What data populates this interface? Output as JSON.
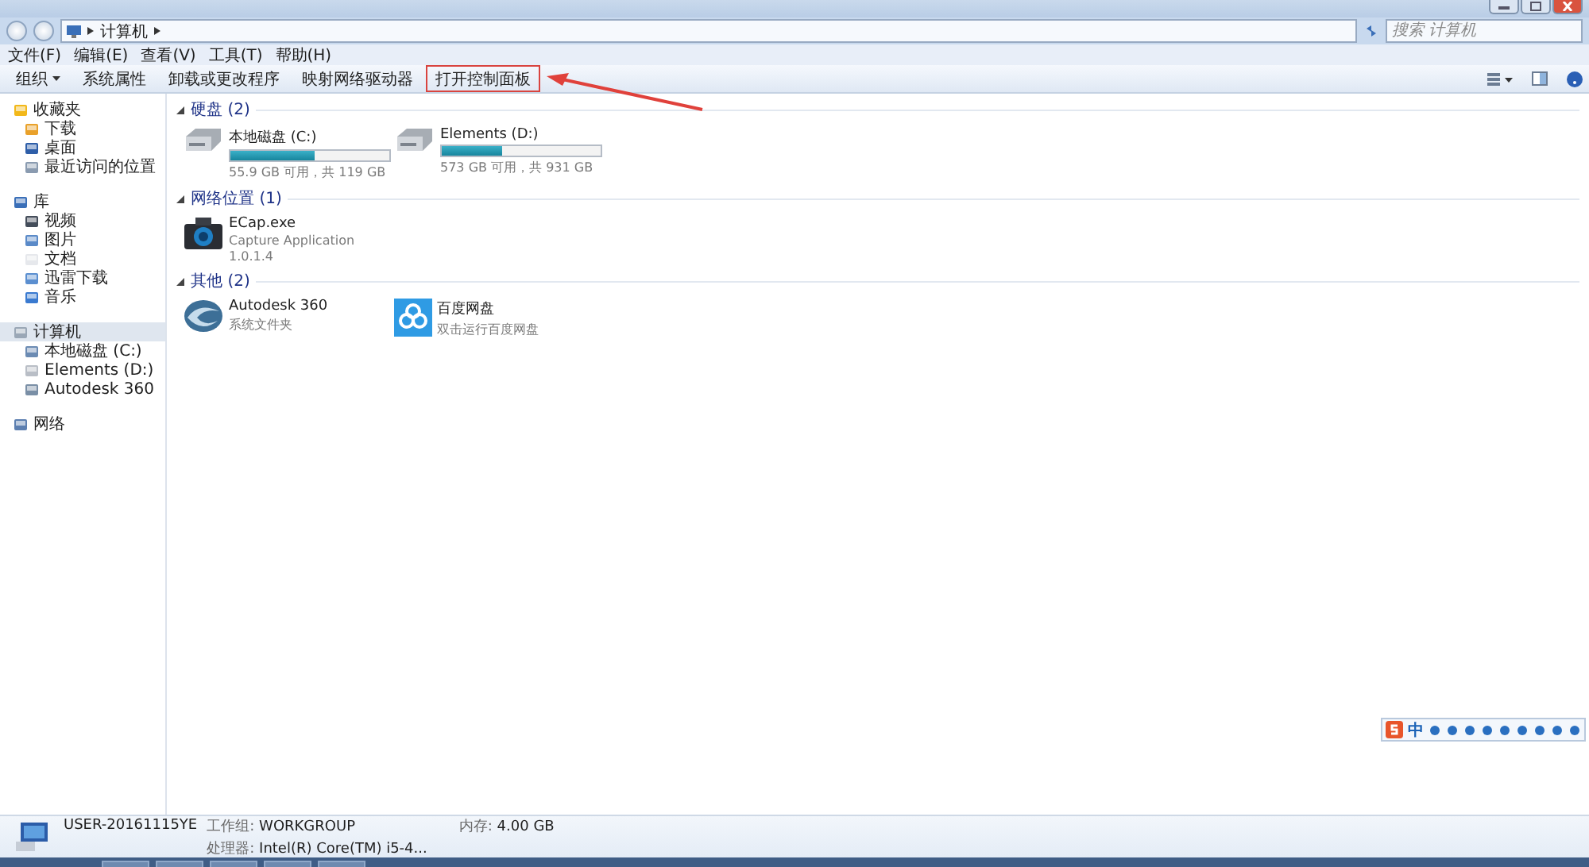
{
  "address": {
    "path": "计算机",
    "search_placeholder": "搜索 计算机"
  },
  "menu": [
    "文件(F)",
    "编辑(E)",
    "查看(V)",
    "工具(T)",
    "帮助(H)"
  ],
  "toolbar": [
    {
      "label": "组织",
      "dropdown": true,
      "annotated": false
    },
    {
      "label": "系统属性",
      "dropdown": false,
      "annotated": false
    },
    {
      "label": "卸载或更改程序",
      "dropdown": false,
      "annotated": false
    },
    {
      "label": "映射网络驱动器",
      "dropdown": false,
      "annotated": false
    },
    {
      "label": "打开控制面板",
      "dropdown": false,
      "annotated": true
    }
  ],
  "sidebar": [
    {
      "label": "收藏夹",
      "selected": false,
      "children": [
        {
          "label": "下载",
          "selected": false
        },
        {
          "label": "桌面",
          "selected": false
        },
        {
          "label": "最近访问的位置",
          "selected": false
        }
      ]
    },
    {
      "label": "库",
      "selected": false,
      "children": [
        {
          "label": "视频",
          "selected": false
        },
        {
          "label": "图片",
          "selected": false
        },
        {
          "label": "文档",
          "selected": false
        },
        {
          "label": "迅雷下载",
          "selected": false
        },
        {
          "label": "音乐",
          "selected": false
        }
      ]
    },
    {
      "label": "计算机",
      "selected": true,
      "children": [
        {
          "label": "本地磁盘 (C:)",
          "selected": false
        },
        {
          "label": "Elements (D:)",
          "selected": false
        },
        {
          "label": "Autodesk 360",
          "selected": false
        }
      ]
    },
    {
      "label": "网络",
      "selected": false
    }
  ],
  "sections": [
    {
      "title": "硬盘",
      "count": "(2)",
      "expanded": true,
      "items": [
        {
          "kind": "drive",
          "name": "本地磁盘 (C:)",
          "level": 0.53,
          "lines": [
            "55.9 GB 可用，共 119 GB"
          ]
        },
        {
          "kind": "drive",
          "name": "Elements (D:)",
          "level": 0.38,
          "lines": [
            "573 GB 可用，共 931 GB"
          ]
        }
      ]
    },
    {
      "title": "网络位置",
      "count": "(1)",
      "expanded": true,
      "items": [
        {
          "kind": "camera",
          "name": "ECap.exe",
          "lines": [
            "Capture Application",
            "1.0.1.4"
          ]
        }
      ]
    },
    {
      "title": "其他",
      "count": "(2)",
      "expanded": true,
      "items": [
        {
          "kind": "swirl",
          "name": "Autodesk 360",
          "lines": [
            "系统文件夹"
          ]
        },
        {
          "kind": "cloud",
          "name": "百度网盘",
          "lines": [
            "双击运行百度网盘"
          ]
        }
      ]
    }
  ],
  "details": {
    "name": "USER-20161115YE",
    "fields": [
      {
        "label": "工作组:",
        "value": "WORKGROUP"
      },
      {
        "label": "内存:",
        "value": "4.00 GB"
      },
      {
        "label": "处理器:",
        "value": "Intel(R) Core(TM) i5-4..."
      }
    ]
  },
  "ime": {
    "mode": "中"
  }
}
